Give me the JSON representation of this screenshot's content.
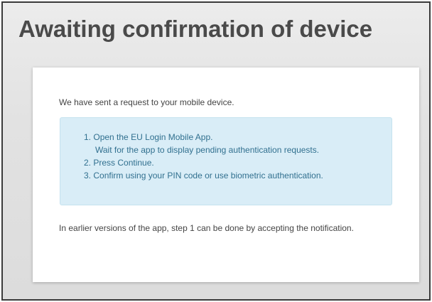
{
  "page": {
    "title": "Awaiting confirmation of device"
  },
  "card": {
    "intro": "We have sent a request to your mobile device.",
    "steps": [
      {
        "number": "1.",
        "text": "Open the EU Login Mobile App.",
        "continuation": "Wait for the app to display pending authentication requests."
      },
      {
        "number": "2.",
        "text": "Press Continue."
      },
      {
        "number": "3.",
        "text": "Confirm using your PIN code or use biometric authentication."
      }
    ],
    "footnote": "In earlier versions of the app, step 1 can be done by accepting the notification."
  },
  "colors": {
    "title": "#4a4a4a",
    "info_box_bg": "#d9edf7",
    "info_box_text": "#31708f",
    "body_text": "#444444"
  }
}
